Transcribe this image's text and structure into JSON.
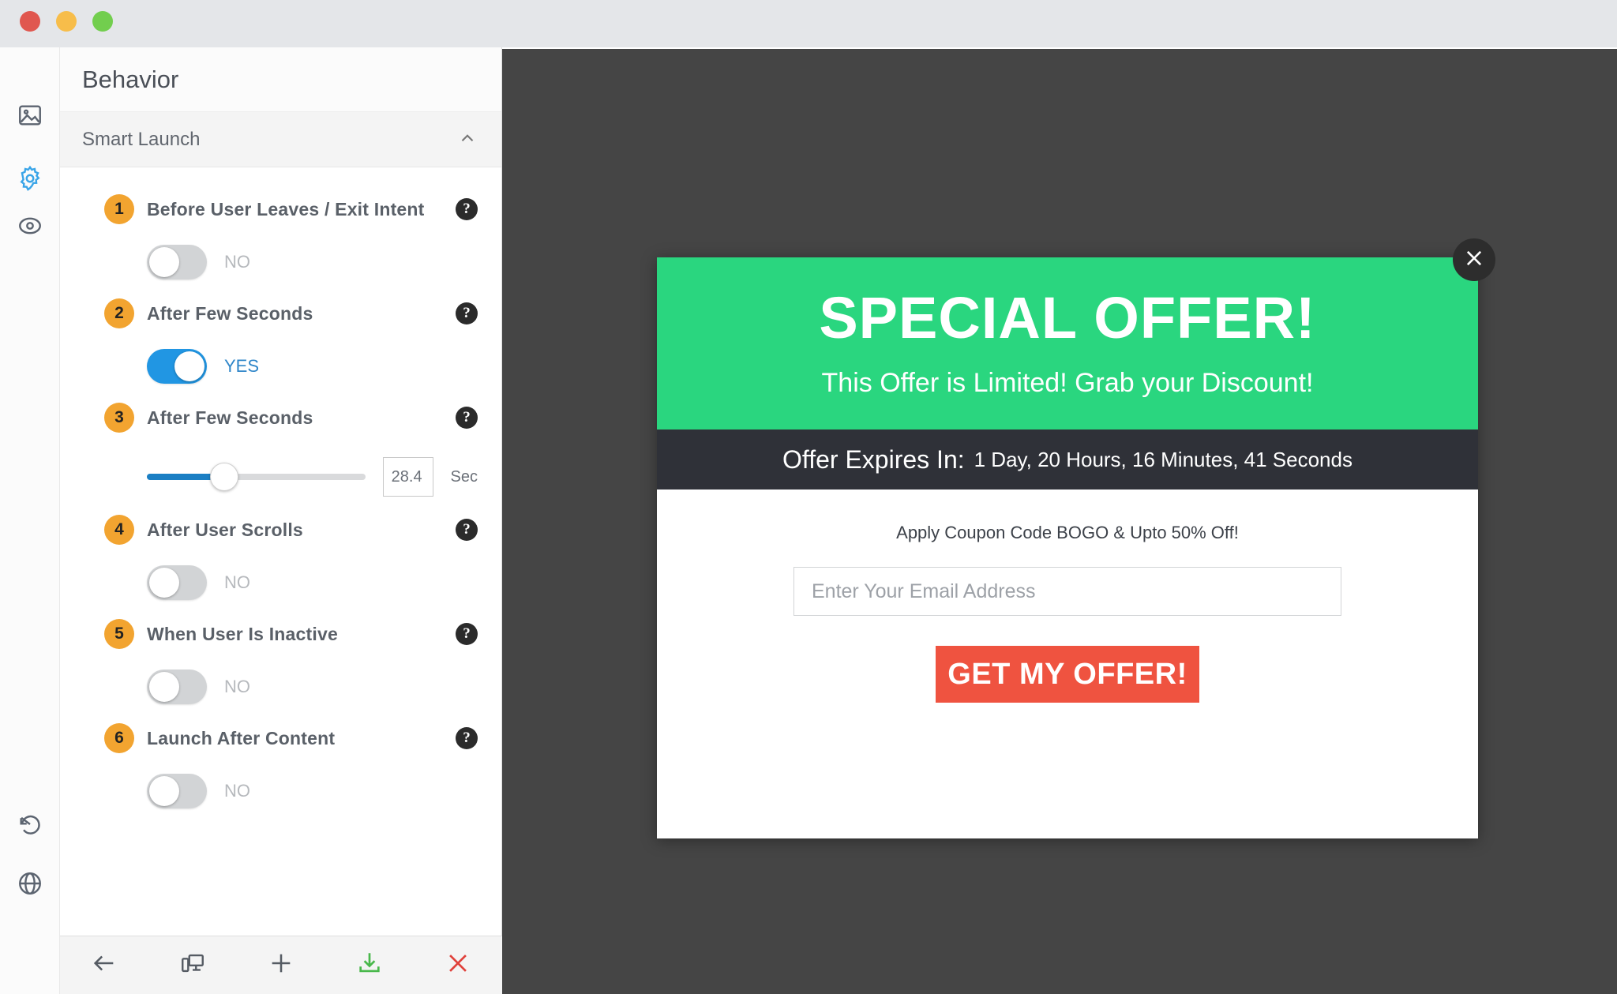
{
  "window": {
    "traffic_lights": [
      "close",
      "minimize",
      "maximize"
    ]
  },
  "rail": {
    "items": [
      {
        "name": "image-icon",
        "label": "Image"
      },
      {
        "name": "gear-icon",
        "label": "Settings",
        "active": true
      },
      {
        "name": "target-icon",
        "label": "Targeting"
      },
      {
        "name": "history-icon",
        "label": "History"
      },
      {
        "name": "globe-icon",
        "label": "Global"
      }
    ]
  },
  "panel": {
    "title": "Behavior",
    "section": {
      "label": "Smart Launch",
      "chevron": "chevron-up-icon"
    },
    "rows": [
      {
        "number": "1",
        "label": "Before User Leaves / Exit Intent",
        "control": "toggle",
        "state": "NO",
        "on": false
      },
      {
        "number": "2",
        "label": "After Few Seconds",
        "control": "toggle",
        "state": "YES",
        "on": true
      },
      {
        "number": "3",
        "label": "After Few Seconds",
        "control": "slider",
        "value": "28.4",
        "unit": "Sec"
      },
      {
        "number": "4",
        "label": "After User Scrolls",
        "control": "toggle",
        "state": "NO",
        "on": false
      },
      {
        "number": "5",
        "label": "When User Is Inactive",
        "control": "toggle",
        "state": "NO",
        "on": false
      },
      {
        "number": "6",
        "label": "Launch After Content",
        "control": "toggle",
        "state": "NO",
        "on": false
      }
    ],
    "help_glyph": "?"
  },
  "toolbar": {
    "buttons": [
      {
        "name": "back-button",
        "icon": "arrow-left-icon"
      },
      {
        "name": "responsive-preview-button",
        "icon": "devices-icon"
      },
      {
        "name": "add-button",
        "icon": "plus-icon"
      },
      {
        "name": "save-button",
        "icon": "download-icon"
      },
      {
        "name": "close-button",
        "icon": "x-icon"
      }
    ]
  },
  "popup": {
    "close_icon": "close-icon",
    "title": "SPECIAL OFFER!",
    "subtitle": "This Offer is Limited! Grab your Discount!",
    "timer_label": "Offer Expires In:",
    "timer_value": "1 Day, 20 Hours, 16 Minutes, 41 Seconds",
    "coupon_text": "Apply Coupon Code BOGO & Upto 50% Off!",
    "email_placeholder": "Enter Your Email Address",
    "cta_label": "GET MY OFFER!"
  },
  "colors": {
    "green_header": "#2ad67f",
    "timer_bar": "#2f3138",
    "cta": "#ef5340",
    "toggle_on": "#2196e3",
    "badge": "#f2a430",
    "canvas": "#454545"
  }
}
